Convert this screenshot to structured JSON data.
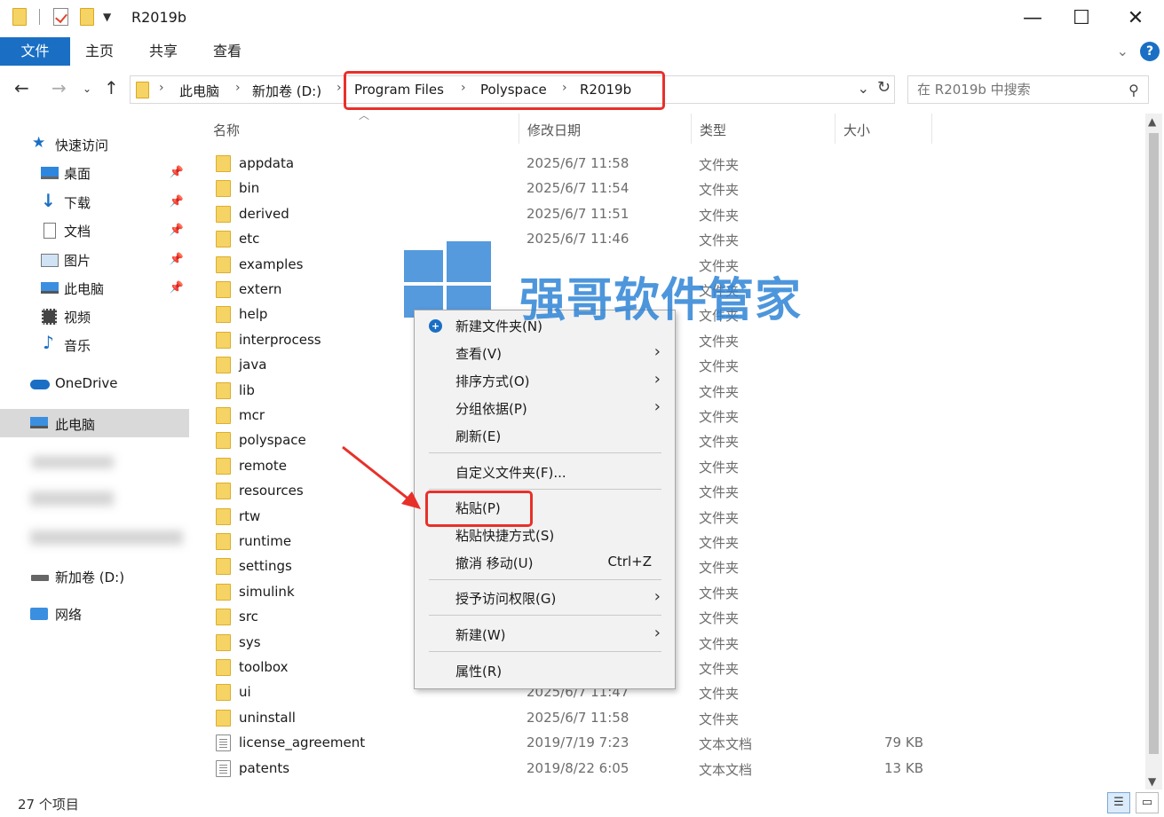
{
  "window": {
    "title": "R2019b"
  },
  "ribbon": {
    "tabs": [
      "文件",
      "主页",
      "共享",
      "查看"
    ]
  },
  "address": {
    "crumbs": [
      "此电脑",
      "新加卷 (D:)",
      "Program Files",
      "Polyspace",
      "R2019b"
    ]
  },
  "search": {
    "placeholder": "在 R2019b 中搜索"
  },
  "sidebar": {
    "items": [
      {
        "label": "快速访问",
        "icon": "star-icon"
      },
      {
        "label": "桌面",
        "icon": "desktop-icon",
        "pinned": true
      },
      {
        "label": "下载",
        "icon": "download-icon",
        "pinned": true
      },
      {
        "label": "文档",
        "icon": "document-icon",
        "pinned": true
      },
      {
        "label": "图片",
        "icon": "pictures-icon",
        "pinned": true
      },
      {
        "label": "此电脑",
        "icon": "computer-icon",
        "pinned": true
      },
      {
        "label": "视频",
        "icon": "video-icon"
      },
      {
        "label": "音乐",
        "icon": "music-icon"
      },
      {
        "label": "OneDrive",
        "icon": "cloud-icon"
      },
      {
        "label": "此电脑",
        "icon": "computer-icon",
        "selected": true
      },
      {
        "label": "新加卷 (D:)",
        "icon": "drive-icon"
      },
      {
        "label": "网络",
        "icon": "network-icon"
      }
    ]
  },
  "columns": {
    "name": "名称",
    "date": "修改日期",
    "type": "类型",
    "size": "大小"
  },
  "files": [
    {
      "name": "appdata",
      "date": "2025/6/7 11:58",
      "type": "文件夹",
      "size": "",
      "kind": "folder"
    },
    {
      "name": "bin",
      "date": "2025/6/7 11:54",
      "type": "文件夹",
      "size": "",
      "kind": "folder"
    },
    {
      "name": "derived",
      "date": "2025/6/7 11:51",
      "type": "文件夹",
      "size": "",
      "kind": "folder"
    },
    {
      "name": "etc",
      "date": "2025/6/7 11:46",
      "type": "文件夹",
      "size": "",
      "kind": "folder"
    },
    {
      "name": "examples",
      "date": "",
      "type": "文件夹",
      "size": "",
      "kind": "folder"
    },
    {
      "name": "extern",
      "date": "",
      "type": "文件夹",
      "size": "",
      "kind": "folder"
    },
    {
      "name": "help",
      "date": "",
      "type": "文件夹",
      "size": "",
      "kind": "folder"
    },
    {
      "name": "interprocess",
      "date": "",
      "type": "文件夹",
      "size": "",
      "kind": "folder"
    },
    {
      "name": "java",
      "date": "",
      "type": "文件夹",
      "size": "",
      "kind": "folder"
    },
    {
      "name": "lib",
      "date": "",
      "type": "文件夹",
      "size": "",
      "kind": "folder"
    },
    {
      "name": "mcr",
      "date": "",
      "type": "文件夹",
      "size": "",
      "kind": "folder"
    },
    {
      "name": "polyspace",
      "date": "",
      "type": "文件夹",
      "size": "",
      "kind": "folder"
    },
    {
      "name": "remote",
      "date": "",
      "type": "文件夹",
      "size": "",
      "kind": "folder"
    },
    {
      "name": "resources",
      "date": "",
      "type": "文件夹",
      "size": "",
      "kind": "folder"
    },
    {
      "name": "rtw",
      "date": "",
      "type": "文件夹",
      "size": "",
      "kind": "folder"
    },
    {
      "name": "runtime",
      "date": "",
      "type": "文件夹",
      "size": "",
      "kind": "folder"
    },
    {
      "name": "settings",
      "date": "",
      "type": "文件夹",
      "size": "",
      "kind": "folder"
    },
    {
      "name": "simulink",
      "date": "",
      "type": "文件夹",
      "size": "",
      "kind": "folder"
    },
    {
      "name": "src",
      "date": "",
      "type": "文件夹",
      "size": "",
      "kind": "folder"
    },
    {
      "name": "sys",
      "date": "",
      "type": "文件夹",
      "size": "",
      "kind": "folder"
    },
    {
      "name": "toolbox",
      "date": "",
      "type": "文件夹",
      "size": "",
      "kind": "folder"
    },
    {
      "name": "ui",
      "date": "2025/6/7 11:47",
      "type": "文件夹",
      "size": "",
      "kind": "folder"
    },
    {
      "name": "uninstall",
      "date": "2025/6/7 11:58",
      "type": "文件夹",
      "size": "",
      "kind": "folder"
    },
    {
      "name": "license_agreement",
      "date": "2019/7/19 7:23",
      "type": "文本文档",
      "size": "79 KB",
      "kind": "doc"
    },
    {
      "name": "patents",
      "date": "2019/8/22 6:05",
      "type": "文本文档",
      "size": "13 KB",
      "kind": "doc"
    }
  ],
  "context_menu": {
    "items": [
      {
        "label": "新建文件夹(N)",
        "key": "",
        "submenu": false
      },
      {
        "label": "查看(V)",
        "key": "",
        "submenu": true
      },
      {
        "label": "排序方式(O)",
        "key": "",
        "submenu": true
      },
      {
        "label": "分组依据(P)",
        "key": "",
        "submenu": true
      },
      {
        "label": "刷新(E)",
        "key": "",
        "submenu": false
      },
      {
        "label": "自定义文件夹(F)...",
        "key": "",
        "submenu": false
      },
      {
        "label": "粘贴(P)",
        "key": "",
        "submenu": false
      },
      {
        "label": "粘贴快捷方式(S)",
        "key": "",
        "submenu": false
      },
      {
        "label": "撤消 移动(U)",
        "key": "Ctrl+Z",
        "submenu": false
      },
      {
        "label": "授予访问权限(G)",
        "key": "",
        "submenu": true
      },
      {
        "label": "新建(W)",
        "key": "",
        "submenu": true
      },
      {
        "label": "属性(R)",
        "key": "",
        "submenu": false
      }
    ]
  },
  "watermark": {
    "text": "强哥软件管家"
  },
  "status": {
    "count": "27 个项目"
  },
  "colors": {
    "accent": "#1a6fc4",
    "highlight": "#e8302a",
    "watermark": "#2f84d6"
  }
}
